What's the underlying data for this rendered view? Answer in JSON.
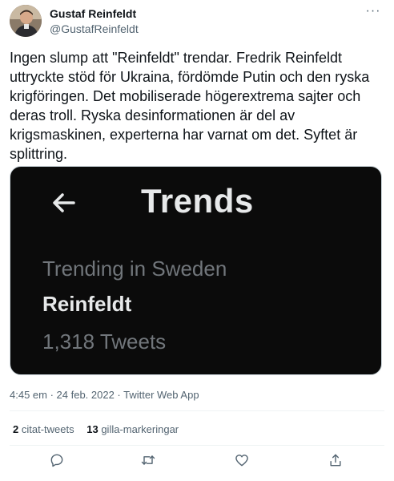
{
  "author": {
    "display_name": "Gustaf Reinfeldt",
    "handle": "@GustafReinfeldt"
  },
  "more_icon": "more-icon",
  "tweet": {
    "text": "Ingen slump att \"Reinfeldt\" trendar. Fredrik Reinfeldt uttryckte stöd för Ukraina, fördömde Putin och den ryska krigföringen. Det mobiliserade högerextrema sajter och deras troll. Ryska desinformationen är del av krigsmaskinen, experterna har varnat om det. Syftet är splittring."
  },
  "media": {
    "header_title": "Trends",
    "trend_location": "Trending in Sweden",
    "trend_name": "Reinfeldt",
    "trend_count": "1,318 Tweets"
  },
  "meta": {
    "timestamp": "4:45 em · 24 feb. 2022 · Twitter Web App"
  },
  "stats": {
    "quotes_count": "2",
    "quotes_label": "citat-tweets",
    "likes_count": "13",
    "likes_label": "gilla-markeringar"
  },
  "actions": [
    "reply-icon",
    "retweet-icon",
    "like-icon",
    "share-icon"
  ],
  "colors": {
    "text_primary": "#0f1419",
    "text_secondary": "#536471",
    "media_bg": "#0b0b0b"
  }
}
